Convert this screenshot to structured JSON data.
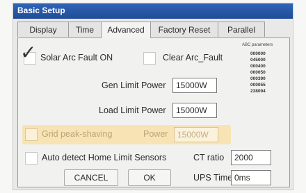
{
  "window": {
    "title": "Basic Setup"
  },
  "tabs": [
    {
      "label": "Display"
    },
    {
      "label": "Time"
    },
    {
      "label": "Advanced",
      "active": true
    },
    {
      "label": "Factory Reset"
    },
    {
      "label": "Parallel"
    }
  ],
  "advanced": {
    "solar_arc_fault": {
      "label": "Solar Arc Fault ON",
      "checked": true
    },
    "clear_arc_fault": {
      "label": "Clear Arc_Fault",
      "checked": false
    },
    "abc_parameters": {
      "title": "ABC parameters",
      "values": [
        "000000",
        "045000",
        "000400",
        "000050",
        "000390",
        "000055",
        "238094"
      ]
    },
    "gen_limit_power": {
      "label": "Gen Limit Power",
      "value": "15000W"
    },
    "load_limit_power": {
      "label": "Load Limit Power",
      "value": "15000W"
    },
    "grid_peak_shaving": {
      "label": "Grid peak-shaving",
      "checked": false,
      "power_label": "Power",
      "power_value": "15000W"
    },
    "auto_detect": {
      "label": "Auto detect Home Limit Sensors",
      "checked": false
    },
    "ct_ratio": {
      "label": "CT ratio",
      "value": "2000"
    },
    "ups_time": {
      "label": "UPS Time",
      "value": "0ms"
    },
    "buttons": {
      "cancel": "CANCEL",
      "ok": "OK"
    }
  },
  "colors": {
    "titlebar": "#1f4c98",
    "highlight": "#f7e3b4"
  }
}
